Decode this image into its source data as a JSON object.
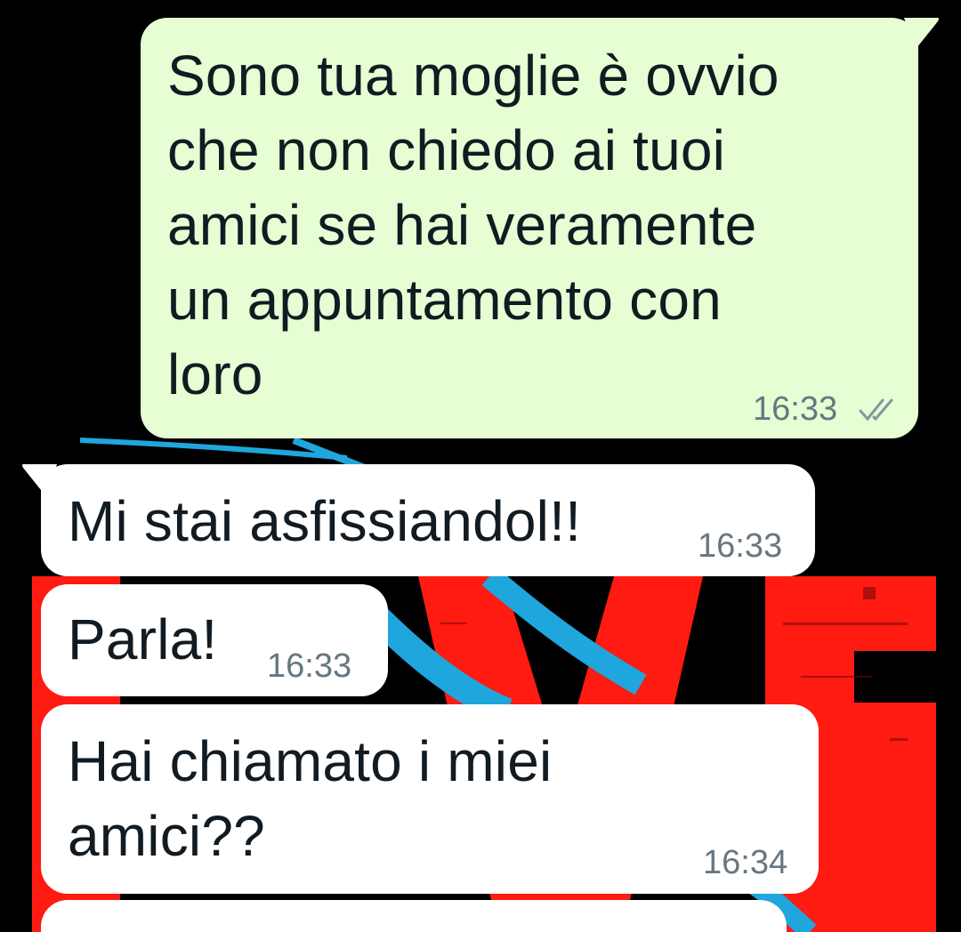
{
  "colors": {
    "outgoing_bubble": "#e7fdd4",
    "incoming_bubble": "#ffffff",
    "text": "#111b21",
    "timestamp": "#667781",
    "wallpaper_background": "#000000",
    "wallpaper_red": "#ff1a12",
    "wallpaper_blue": "#1fa6dc"
  },
  "messages": [
    {
      "direction": "outgoing",
      "text": "Sono tua moglie è ovvio\nche non chiedo ai tuoi\namici se hai veramente\nun appuntamento con\nloro",
      "time": "16:33",
      "status_icon": "double-check-icon"
    },
    {
      "direction": "incoming",
      "text": "Mi stai asfissiandol!!",
      "time": "16:33"
    },
    {
      "direction": "incoming",
      "text": "Parla!",
      "time": "16:33"
    },
    {
      "direction": "incoming",
      "text": "Hai chiamato i miei\namici??",
      "time": "16:34"
    }
  ]
}
